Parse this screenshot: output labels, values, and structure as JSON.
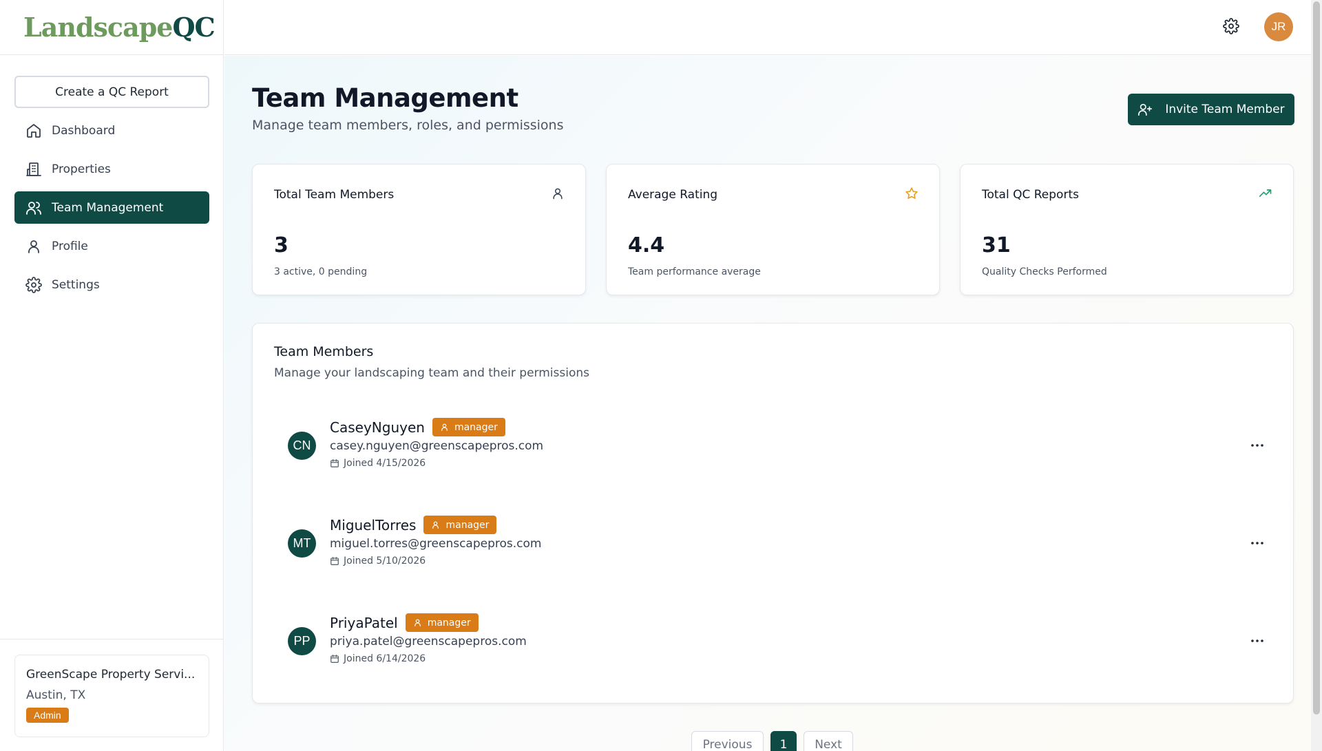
{
  "brand": {
    "logo_part1": "Landscape",
    "logo_part2": "QC"
  },
  "sidebar": {
    "create_button": "Create a QC Report",
    "items": [
      {
        "label": "Dashboard",
        "icon": "home-icon",
        "active": false
      },
      {
        "label": "Properties",
        "icon": "building-icon",
        "active": false
      },
      {
        "label": "Team Management",
        "icon": "users-icon",
        "active": true
      },
      {
        "label": "Profile",
        "icon": "user-icon",
        "active": false
      },
      {
        "label": "Settings",
        "icon": "gear-icon",
        "active": false
      }
    ],
    "org": {
      "name": "GreenScape Property Servi...",
      "location": "Austin, TX",
      "role": "Admin"
    }
  },
  "topbar": {
    "settings_icon": "gear-icon",
    "avatar_initials": "JR"
  },
  "header": {
    "title": "Team Management",
    "subtitle": "Manage team members, roles, and permissions",
    "invite_button": "Invite Team Member"
  },
  "stats": [
    {
      "title": "Total Team Members",
      "value": "3",
      "description": "3 active, 0 pending",
      "icon": "user-icon"
    },
    {
      "title": "Average Rating",
      "value": "4.4",
      "description": "Team performance average",
      "icon": "star-icon"
    },
    {
      "title": "Total QC Reports",
      "value": "31",
      "description": "Quality Checks Performed",
      "icon": "trending-up-icon"
    }
  ],
  "members_section": {
    "title": "Team Members",
    "subtitle": "Manage your landscaping team and their permissions",
    "members": [
      {
        "initials": "CN",
        "name": "CaseyNguyen",
        "role": "manager",
        "email": "casey.nguyen@greenscapepros.com",
        "joined": "Joined 4/15/2026"
      },
      {
        "initials": "MT",
        "name": "MiguelTorres",
        "role": "manager",
        "email": "miguel.torres@greenscapepros.com",
        "joined": "Joined 5/10/2026"
      },
      {
        "initials": "PP",
        "name": "PriyaPatel",
        "role": "manager",
        "email": "priya.patel@greenscapepros.com",
        "joined": "Joined 6/14/2026"
      }
    ]
  },
  "pagination": {
    "previous": "Previous",
    "current": "1",
    "next": "Next"
  },
  "colors": {
    "primary": "#0f4a45",
    "accent": "#d97b17",
    "brand_green": "#6d9a5d",
    "star": "#e8a020",
    "trend": "#17a36b"
  }
}
